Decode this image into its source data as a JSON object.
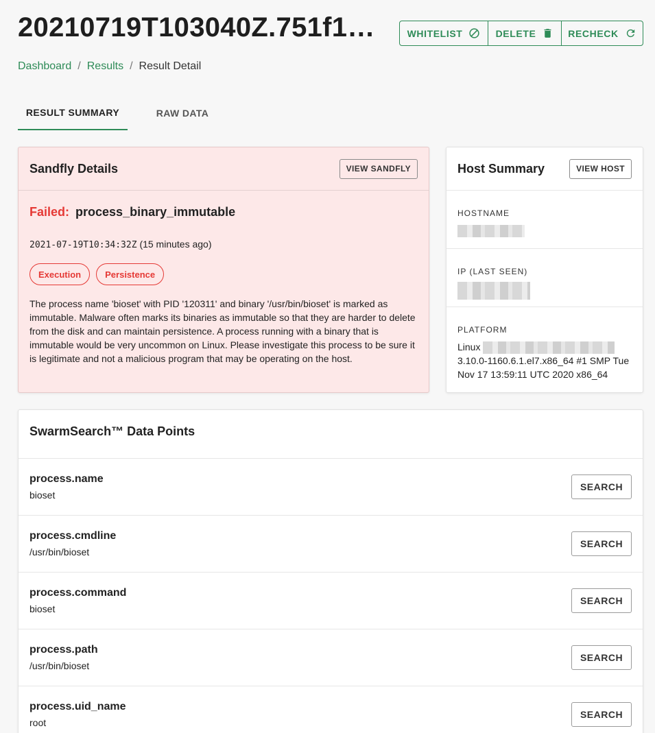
{
  "header": {
    "title": "20210719T103040Z.751f12…",
    "actions": [
      {
        "label": "WHITELIST",
        "icon": "block-icon"
      },
      {
        "label": "DELETE",
        "icon": "trash-icon"
      },
      {
        "label": "RECHECK",
        "icon": "refresh-icon"
      }
    ]
  },
  "breadcrumb": {
    "items": [
      "Dashboard",
      "Results",
      "Result Detail"
    ],
    "separator": "/"
  },
  "tabs": [
    {
      "label": "RESULT SUMMARY",
      "active": true
    },
    {
      "label": "RAW DATA",
      "active": false
    }
  ],
  "sandfly": {
    "title": "Sandfly Details",
    "view_button": "VIEW SANDFLY",
    "status_label": "Failed:",
    "sandfly_name": "process_binary_immutable",
    "timestamp": "2021-07-19T10:34:32Z",
    "relative_time": "(15 minutes ago)",
    "tags": [
      "Execution",
      "Persistence"
    ],
    "description": "The process name 'bioset' with PID '120311' and binary '/usr/bin/bioset' is marked as immutable. Malware often marks its binaries as immutable so that they are harder to delete from the disk and can maintain persistence. A process running with a binary that is immutable would be very uncommon on Linux. Please investigate this process to be sure it is legitimate and not a malicious program that may be operating on the host."
  },
  "host": {
    "title": "Host Summary",
    "view_button": "VIEW HOST",
    "hostname_label": "HOSTNAME",
    "ip_label": "IP (LAST SEEN)",
    "platform_label": "PLATFORM",
    "platform_prefix": "Linux",
    "platform_rest": "3.10.0-1160.6.1.el7.x86_64 #1 SMP Tue Nov 17 13:59:11 UTC 2020 x86_64"
  },
  "swarm": {
    "title": "SwarmSearch™ Data Points",
    "search_label": "SEARCH",
    "points": [
      {
        "key": "process.name",
        "value": "bioset"
      },
      {
        "key": "process.cmdline",
        "value": "/usr/bin/bioset"
      },
      {
        "key": "process.command",
        "value": "bioset"
      },
      {
        "key": "process.path",
        "value": "/usr/bin/bioset"
      },
      {
        "key": "process.uid_name",
        "value": "root"
      }
    ]
  },
  "colors": {
    "accent": "#2e8b57",
    "danger": "#e53935",
    "alert_bg": "#fde8e8"
  }
}
